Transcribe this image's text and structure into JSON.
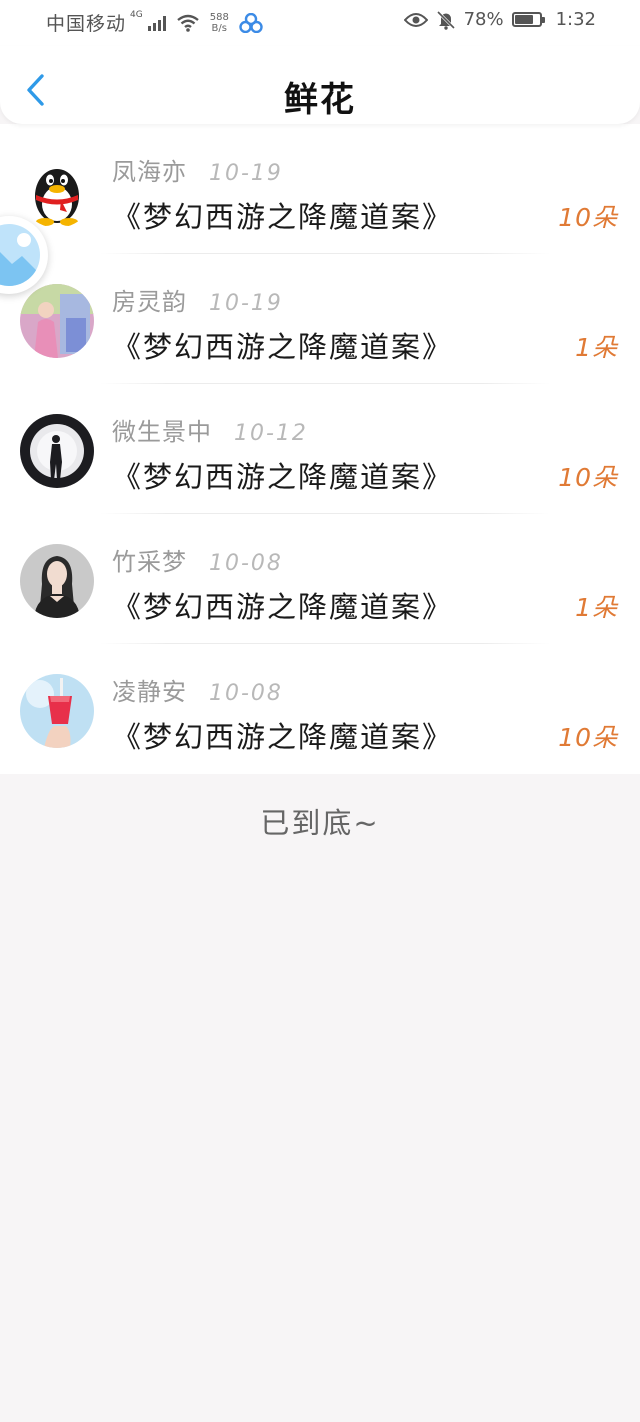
{
  "status_bar": {
    "carrier": "中国移动",
    "network_type": "4G",
    "net_speed_value": "588",
    "net_speed_unit": "B/s",
    "battery_percent": "78%",
    "battery_level": 0.78,
    "time": "1:32",
    "icons": [
      "signal-icon",
      "wifi-icon",
      "app-notification-icon",
      "eye-icon",
      "bell-off-icon",
      "battery-icon"
    ]
  },
  "header": {
    "title": "鲜花",
    "back_icon": "chevron-left-icon"
  },
  "gifts": [
    {
      "sender": "凤海亦",
      "date": "10-19",
      "title": "《梦幻西游之降魔道案》",
      "count": "10朵",
      "avatar": "penguin-avatar"
    },
    {
      "sender": "房灵韵",
      "date": "10-19",
      "title": "《梦幻西游之降魔道案》",
      "count": "1朵",
      "avatar": "photo-avatar"
    },
    {
      "sender": "微生景中",
      "date": "10-12",
      "title": "《梦幻西游之降魔道案》",
      "count": "10朵",
      "avatar": "silhouette-avatar"
    },
    {
      "sender": "竹采梦",
      "date": "10-08",
      "title": "《梦幻西游之降魔道案》",
      "count": "1朵",
      "avatar": "portrait-avatar"
    },
    {
      "sender": "凌静安",
      "date": "10-08",
      "title": "《梦幻西游之降魔道案》",
      "count": "10朵",
      "avatar": "drink-avatar"
    }
  ],
  "end_text": "已到底~",
  "colors": {
    "accent": "#2f9ae8",
    "count": "#e07a35",
    "background": "#f7f5f6"
  }
}
